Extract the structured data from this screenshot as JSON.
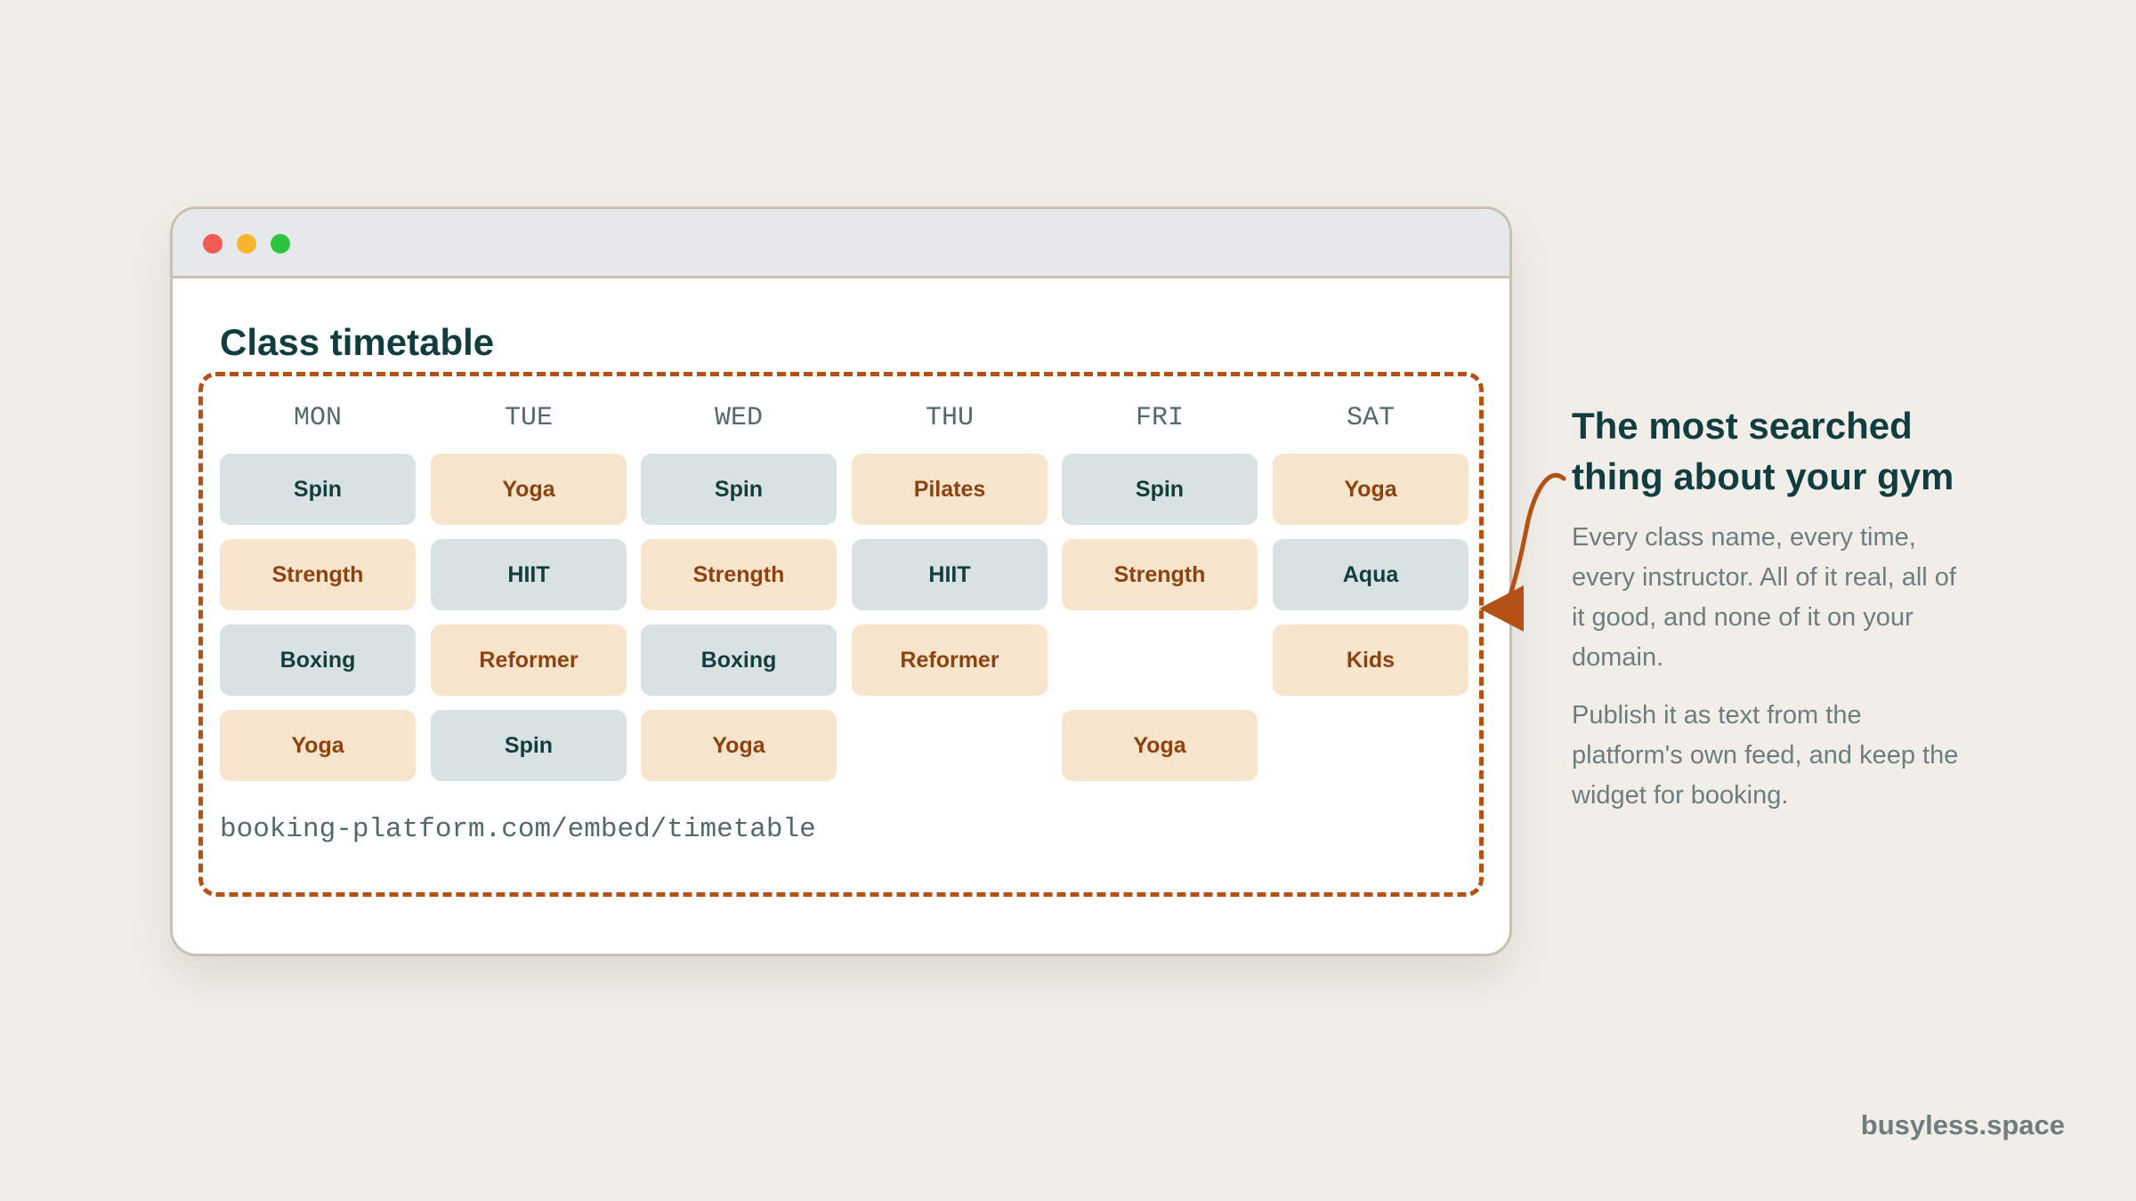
{
  "window": {
    "title": "Class timetable"
  },
  "timetable": {
    "days": [
      "MON",
      "TUE",
      "WED",
      "THU",
      "FRI",
      "SAT"
    ],
    "rows": [
      [
        "Spin",
        "Yoga",
        "Spin",
        "Pilates",
        "Spin",
        "Yoga"
      ],
      [
        "Strength",
        "HIIT",
        "Strength",
        "HIIT",
        "Strength",
        "Aqua"
      ],
      [
        "Boxing",
        "Reformer",
        "Boxing",
        "Reformer",
        "",
        "Kids"
      ],
      [
        "Yoga",
        "Spin",
        "Yoga",
        "",
        "Yoga",
        ""
      ]
    ],
    "embed_url": "booking-platform.com/embed/timetable"
  },
  "callout": {
    "heading": "The most searched thing about your gym",
    "paragraph_1": "Every class name, every time, every instructor. All of it real, all of it good, and none of it on your domain.",
    "paragraph_2": "Publish it as text from the platform's own feed, and keep the widget for booking."
  },
  "brand": "busyless.space",
  "colors": {
    "background": "#f1eee9",
    "accent": "#b45215",
    "heading": "#123d3f",
    "cell_teal": "#d9e2e2",
    "cell_peach": "#f7e4cd"
  }
}
